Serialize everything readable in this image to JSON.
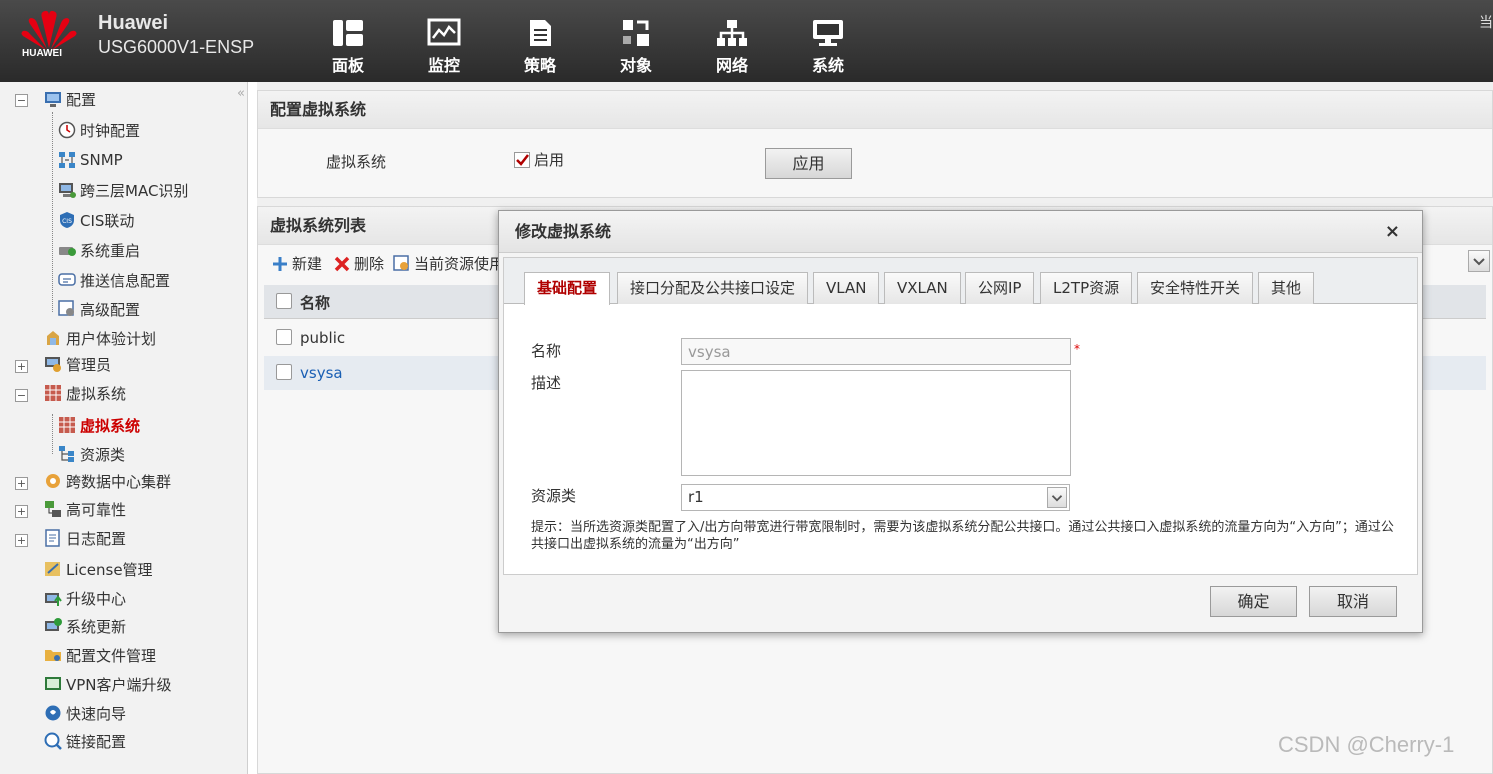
{
  "header": {
    "brand_word": "HUAWEI",
    "brand_name": "Huawei",
    "model": "USG6000V1-ENSP",
    "nav": [
      {
        "label": "面板",
        "icon": "dashboard-icon"
      },
      {
        "label": "监控",
        "icon": "monitor-icon"
      },
      {
        "label": "策略",
        "icon": "policy-icon"
      },
      {
        "label": "对象",
        "icon": "object-icon"
      },
      {
        "label": "网络",
        "icon": "network-icon"
      },
      {
        "label": "系统",
        "icon": "system-icon"
      }
    ],
    "right_text": "当"
  },
  "sidebar": {
    "items": [
      {
        "label": "配置"
      },
      {
        "label": "时钟配置"
      },
      {
        "label": "SNMP"
      },
      {
        "label": "跨三层MAC识别"
      },
      {
        "label": "CIS联动"
      },
      {
        "label": "系统重启"
      },
      {
        "label": "推送信息配置"
      },
      {
        "label": "高级配置"
      },
      {
        "label": "用户体验计划"
      },
      {
        "label": "管理员"
      },
      {
        "label": "虚拟系统"
      },
      {
        "label": "虚拟系统"
      },
      {
        "label": "资源类"
      },
      {
        "label": "跨数据中心集群"
      },
      {
        "label": "高可靠性"
      },
      {
        "label": "日志配置"
      },
      {
        "label": "License管理"
      },
      {
        "label": "升级中心"
      },
      {
        "label": "系统更新"
      },
      {
        "label": "配置文件管理"
      },
      {
        "label": "VPN客户端升级"
      },
      {
        "label": "快速向导"
      },
      {
        "label": "链接配置"
      }
    ]
  },
  "config_panel": {
    "title": "配置虚拟系统",
    "field_label": "虚拟系统",
    "enable_label": "启用",
    "enabled": true,
    "apply_label": "应用"
  },
  "list_panel": {
    "title": "虚拟系统列表",
    "toolbar": {
      "new_label": "新建",
      "delete_label": "删除",
      "resource_label": "当前资源使用"
    },
    "column_name": "名称",
    "rows": [
      {
        "name": "public"
      },
      {
        "name": "vsysa"
      }
    ]
  },
  "dialog": {
    "title": "修改虚拟系统",
    "close_label": "×",
    "tabs": [
      "基础配置",
      "接口分配及公共接口设定",
      "VLAN",
      "VXLAN",
      "公网IP",
      "L2TP资源",
      "安全特性开关",
      "其他"
    ],
    "active_tab": "基础配置",
    "name_label": "名称",
    "name_value": "vsysa",
    "required_mark": "*",
    "desc_label": "描述",
    "desc_value": "",
    "resource_label": "资源类",
    "resource_value": "r1",
    "hint": "提示：当所选资源类配置了入/出方向带宽进行带宽限制时，需要为该虚拟系统分配公共接口。通过公共接口入虚拟系统的流量方向为“入方向”；通过公共接口出虚拟系统的流量为“出方向”",
    "ok_label": "确定",
    "cancel_label": "取消"
  },
  "watermark": "CSDN @Cherry-1",
  "colors": {
    "active_red": "#c00000",
    "link_blue": "#1a5fb4",
    "header_dark": "#333333"
  }
}
